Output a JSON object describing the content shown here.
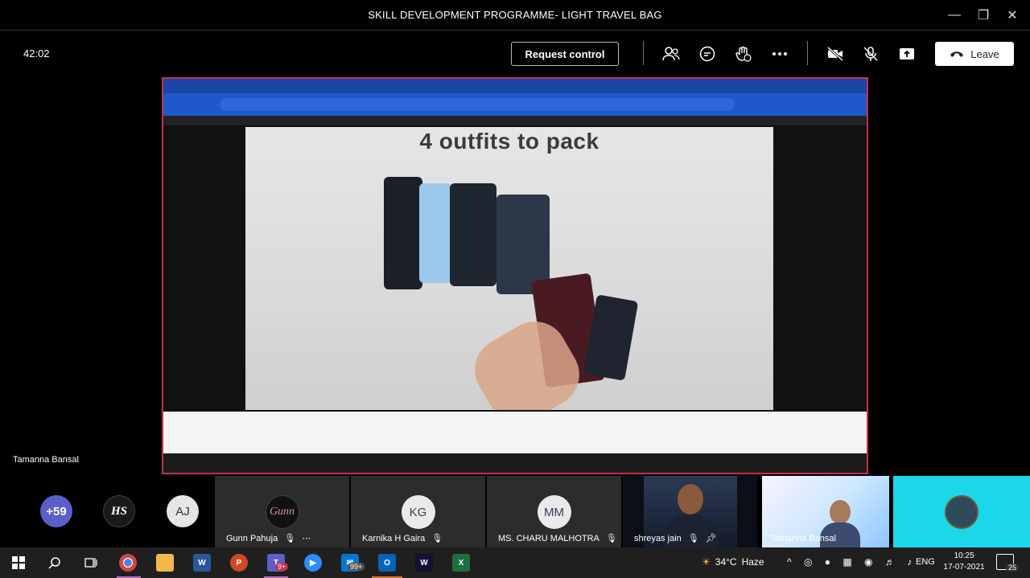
{
  "window": {
    "title": "SKILL DEVELOPMENT PROGRAMME- LIGHT TRAVEL BAG"
  },
  "toolbar": {
    "timer": "42:02",
    "request_control_label": "Request control",
    "leave_label": "Leave"
  },
  "share": {
    "video_caption": "4 outfits to pack",
    "presenter_name": "Tamanna Bansal"
  },
  "participants": {
    "overflow_count": "+59",
    "avatars": [
      {
        "initials": "HS"
      },
      {
        "initials": "AJ"
      }
    ],
    "tiles": [
      {
        "name": "Gunn Pahuja",
        "avatar_text": "Gunn"
      },
      {
        "name": "Karnika H Gaira",
        "avatar_text": "KG"
      },
      {
        "name": "MS. CHARU MALHOTRA",
        "avatar_text": "MM"
      },
      {
        "name": "shreyas jain"
      },
      {
        "name": "Tamanna Bansal"
      }
    ]
  },
  "taskbar": {
    "mail_badge": "99+",
    "teams_badge": "9+",
    "temperature": "34°C",
    "weather": "Haze",
    "language": "ENG",
    "time": "10:25",
    "date": "17-07-2021",
    "notifications": "25"
  },
  "colors": {
    "share_border": "#c4314b",
    "overflow_badge": "#5b5fc7",
    "teal_tile": "#1cd7e7"
  }
}
